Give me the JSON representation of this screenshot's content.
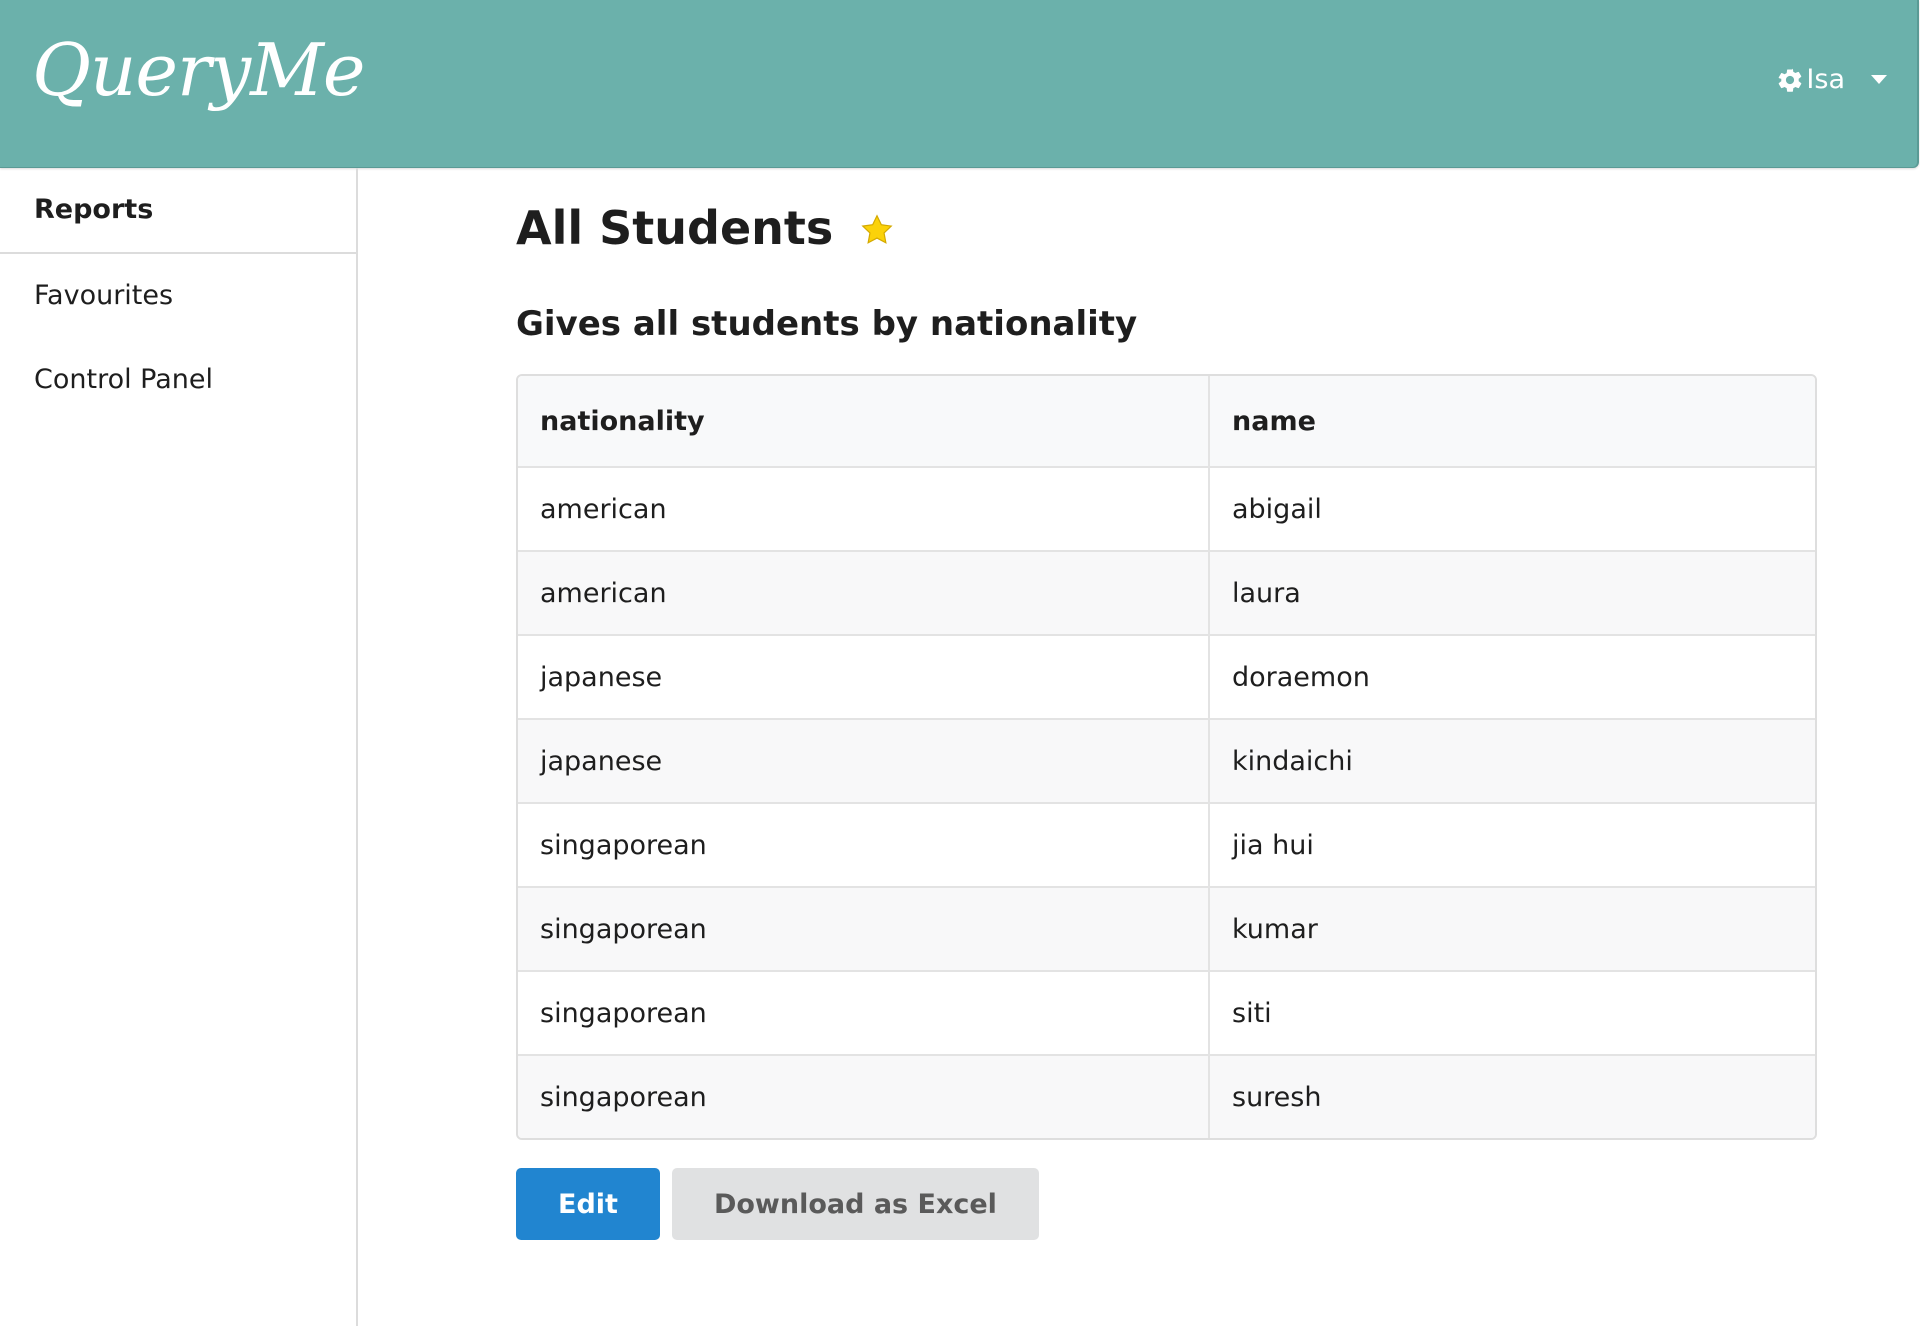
{
  "app": {
    "logo": "QueryMe",
    "user_name": "Isa"
  },
  "sidebar": {
    "items": [
      {
        "label": "Reports",
        "active": true
      },
      {
        "label": "Favourites",
        "active": false
      },
      {
        "label": "Control Panel",
        "active": false
      }
    ]
  },
  "report": {
    "title": "All Students",
    "favourite": true,
    "description": "Gives all students by nationality",
    "columns": [
      "nationality",
      "name"
    ],
    "rows": [
      [
        "american",
        "abigail"
      ],
      [
        "american",
        "laura"
      ],
      [
        "japanese",
        "doraemon"
      ],
      [
        "japanese",
        "kindaichi"
      ],
      [
        "singaporean",
        "jia hui"
      ],
      [
        "singaporean",
        "kumar"
      ],
      [
        "singaporean",
        "siti"
      ],
      [
        "singaporean",
        "suresh"
      ]
    ]
  },
  "actions": {
    "edit_label": "Edit",
    "download_label": "Download as Excel"
  },
  "colors": {
    "header_bg": "#6bb1ab",
    "primary": "#2185d0",
    "star": "#fbd20a"
  }
}
